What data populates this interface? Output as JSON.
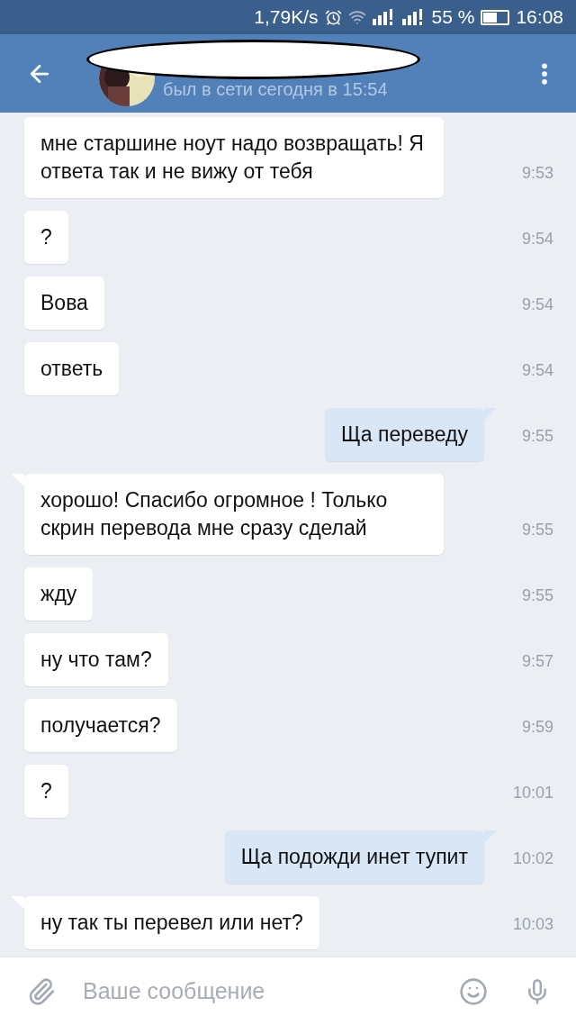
{
  "status_bar": {
    "speed": "1,79K/s",
    "battery_percent": "55 %",
    "time": "16:08"
  },
  "header": {
    "last_seen": "был в сети сегодня в 15:54"
  },
  "messages": [
    {
      "text": "мне старшине ноут надо возвращать! Я ответа так и не вижу от тебя",
      "time": "9:53",
      "outgoing": false,
      "tail": false
    },
    {
      "text": "?",
      "time": "9:54",
      "outgoing": false,
      "tail": false
    },
    {
      "text": "Вова",
      "time": "9:54",
      "outgoing": false,
      "tail": false
    },
    {
      "text": "ответь",
      "time": "9:54",
      "outgoing": false,
      "tail": false
    },
    {
      "text": "Ща переведу",
      "time": "9:55",
      "outgoing": true,
      "tail": true
    },
    {
      "text": "хорошо! Спасибо огромное ! Только скрин перевода мне сразу сделай",
      "time": "9:55",
      "outgoing": false,
      "tail": true
    },
    {
      "text": "жду",
      "time": "9:55",
      "outgoing": false,
      "tail": false
    },
    {
      "text": "ну что там?",
      "time": "9:57",
      "outgoing": false,
      "tail": false
    },
    {
      "text": "получается?",
      "time": "9:59",
      "outgoing": false,
      "tail": false
    },
    {
      "text": "?",
      "time": "10:01",
      "outgoing": false,
      "tail": false
    },
    {
      "text": "Ща подожди инет тупит",
      "time": "10:02",
      "outgoing": true,
      "tail": true
    },
    {
      "text": "ну так ты перевел или нет?",
      "time": "10:03",
      "outgoing": false,
      "tail": true
    }
  ],
  "composer": {
    "placeholder": "Ваше сообщение"
  }
}
